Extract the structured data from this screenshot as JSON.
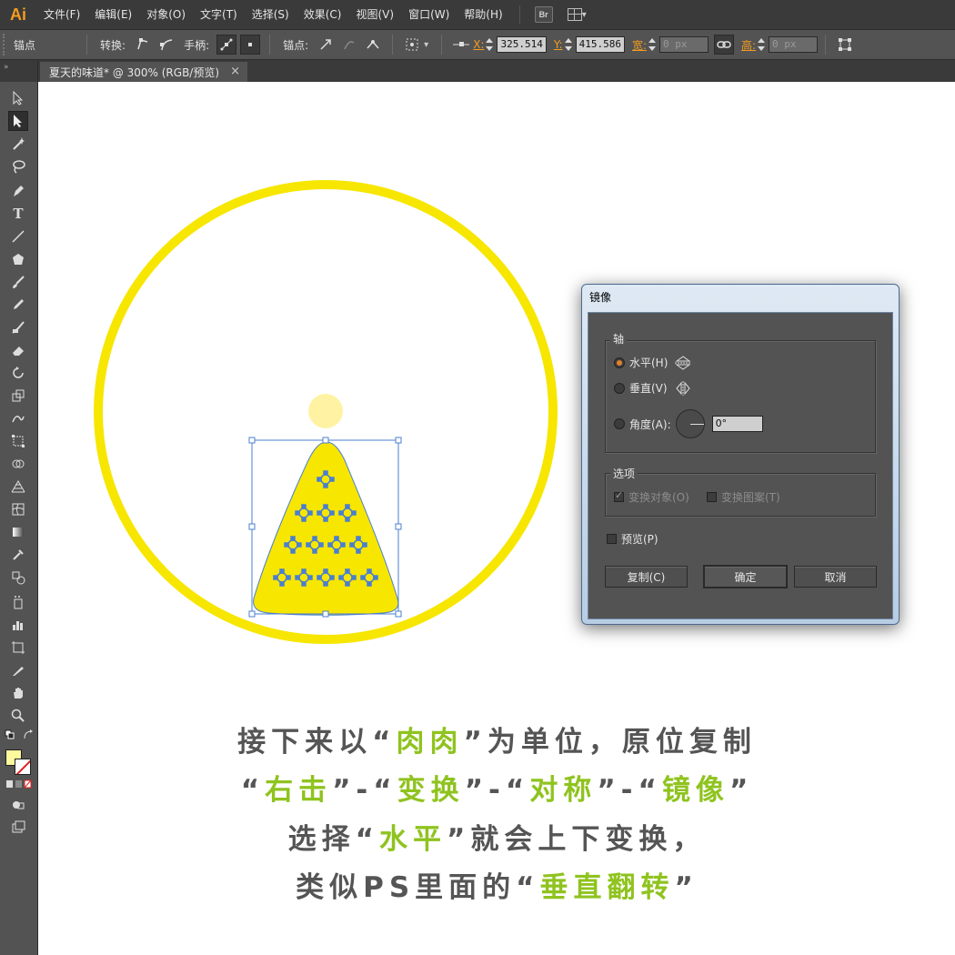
{
  "app": {
    "logo": "Ai"
  },
  "menu": [
    "文件(F)",
    "编辑(E)",
    "对象(O)",
    "文字(T)",
    "选择(S)",
    "效果(C)",
    "视图(V)",
    "窗口(W)",
    "帮助(H)"
  ],
  "menu_extra": {
    "bridge": "Br"
  },
  "control_bar": {
    "anchor_label": "锚点",
    "convert_label": "转换:",
    "handles_label": "手柄:",
    "anchors_label": "锚点:",
    "x_label": "X:",
    "x_value": "325.514",
    "y_label": "Y:",
    "y_value": "415.586",
    "w_label": "宽:",
    "w_value": "0 px",
    "h_label": "高:",
    "h_value": "0 px"
  },
  "document_tab": {
    "title": "夏天的味道* @ 300% (RGB/预览)",
    "close": "×"
  },
  "tools_panel": {
    "header": "»"
  },
  "colors": {
    "yellow": "#f7e600",
    "light_yellow": "#fff3a3",
    "selection": "#4a7fd0",
    "accent_green": "#8fc31f",
    "caption_gray": "#555555"
  },
  "dialog": {
    "title": "镜像",
    "axis_group": "轴",
    "horizontal": "水平(H)",
    "vertical": "垂直(V)",
    "angle": "角度(A):",
    "angle_value": "0°",
    "options_group": "选项",
    "transform_objects": "变换对象(O)",
    "transform_patterns": "变换图案(T)",
    "preview": "预览(P)",
    "copy_button": "复制(C)",
    "ok_button": "确定",
    "cancel_button": "取消"
  },
  "caption": {
    "l1_a": "接下来以“",
    "l1_b": "肉肉",
    "l1_c": "”为单位，原位复制",
    "l2_a": "“",
    "l2_b": "右击",
    "l2_c": "”-“",
    "l2_d": "变换",
    "l2_e": "”-“",
    "l2_f": "对称",
    "l2_g": "”-“",
    "l2_h": "镜像",
    "l2_i": "”",
    "l3_a": "选择“",
    "l3_b": "水平",
    "l3_c": "”就会上下变换，",
    "l4_a": "类似PS里面的“",
    "l4_b": "垂直翻转",
    "l4_c": "”"
  }
}
